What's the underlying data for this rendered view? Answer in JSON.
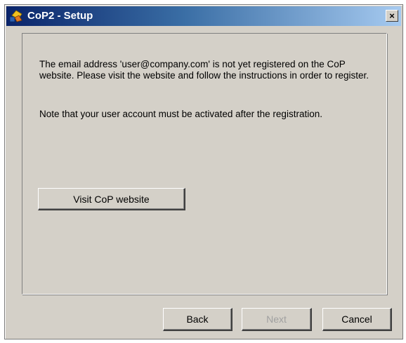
{
  "window": {
    "title": "CoP2 - Setup",
    "close_label": "×",
    "title_gradient_start": "#0a246a",
    "title_gradient_end": "#a6caf0"
  },
  "icons": {
    "app": "cop-app-icon",
    "close": "close-icon"
  },
  "content": {
    "message": "The email address 'user@company.com' is not yet registered on the CoP website. Please visit the website and follow the instructions in order to register.",
    "note": "Note that your user account must be activated after the registration.",
    "visit_button": "Visit CoP website"
  },
  "footer": {
    "back": "Back",
    "next": "Next",
    "next_disabled": true,
    "cancel": "Cancel"
  }
}
